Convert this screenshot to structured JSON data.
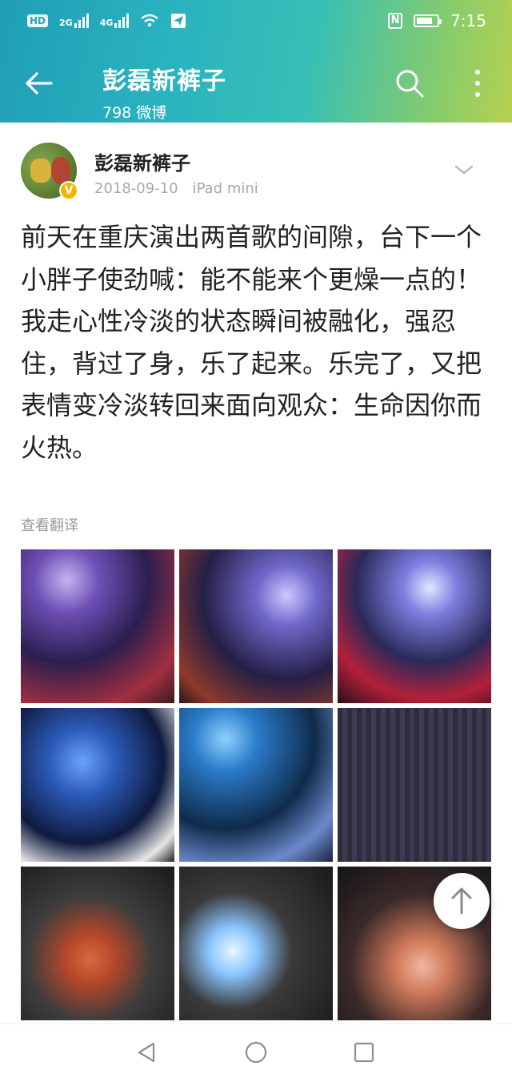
{
  "status_bar": {
    "hd_label": "HD",
    "network_2g": "2G",
    "network_4g": "4G",
    "time": "7:15",
    "nfc_label": "N",
    "battery_level": 0.8
  },
  "header": {
    "title": "彭磊新裤子",
    "subtitle": "798 微博"
  },
  "post": {
    "author": "彭磊新裤子",
    "date": "2018-09-10",
    "device": "iPad mini",
    "verified_symbol": "V",
    "text": "前天在重庆演出两首歌的间隙，台下一个小胖子使劲喊：能不能来个更燥一点的！我走心性冷淡的状态瞬间被融化，强忍住，背过了身，乐了起来。乐完了，又把表情变冷淡转回来面向观众：生命因你而火热。",
    "translate_label": "查看翻译"
  },
  "photos": [
    "photo-1",
    "photo-2",
    "photo-3",
    "photo-4",
    "photo-5",
    "photo-6",
    "photo-7",
    "photo-8",
    "photo-9"
  ],
  "icons": {
    "back": "back-arrow-icon",
    "search": "search-icon",
    "more": "more-vertical-icon",
    "chevron": "chevron-down-icon",
    "up": "arrow-up-icon",
    "nav_back": "triangle-back-icon",
    "nav_home": "circle-home-icon",
    "nav_recent": "square-recent-icon"
  },
  "colors": {
    "header_gradient_start": "#1f9fb6",
    "header_gradient_end": "#b7d14f",
    "verify_badge": "#f5b400",
    "meta_text": "#a8a8a8"
  }
}
